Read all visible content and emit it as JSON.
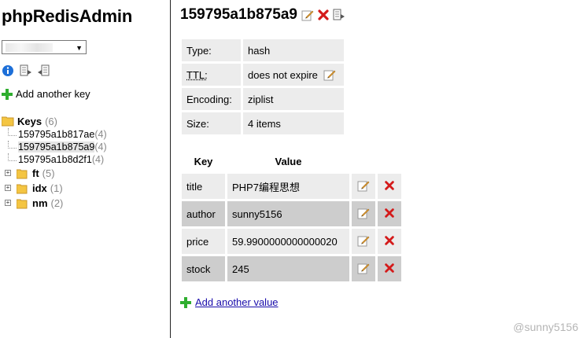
{
  "app": {
    "title": "phpRedisAdmin"
  },
  "sidebar": {
    "server_select_arrow": "▼",
    "icons": [
      "info-icon",
      "export-icon",
      "import-icon"
    ],
    "add_key_label": "Add another key",
    "tree": {
      "root_label": "Keys",
      "root_count": "(6)",
      "keys": [
        {
          "name": "159795a1b817ae",
          "count": "(4)"
        },
        {
          "name": "159795a1b875a9",
          "count": "(4)",
          "selected": true
        },
        {
          "name": "159795a1b8d2f1",
          "count": "(4)"
        }
      ],
      "folders": [
        {
          "name": "ft",
          "count": "(5)"
        },
        {
          "name": "idx",
          "count": "(1)"
        },
        {
          "name": "nm",
          "count": "(2)"
        }
      ]
    }
  },
  "key": {
    "name": "159795a1b875a9",
    "info": {
      "type_label": "Type:",
      "type_value": "hash",
      "ttl_label": "TTL:",
      "ttl_value": "does not expire",
      "encoding_label": "Encoding:",
      "encoding_value": "ziplist",
      "size_label": "Size:",
      "size_value": "4 items"
    },
    "hash": {
      "col_key": "Key",
      "col_value": "Value",
      "rows": [
        {
          "key": "title",
          "value": "PHP7编程思想"
        },
        {
          "key": "author",
          "value": "sunny5156"
        },
        {
          "key": "price",
          "value": "59.9900000000000020"
        },
        {
          "key": "stock",
          "value": "245"
        }
      ]
    },
    "add_value_label": "Add another value"
  },
  "watermark": "@sunny5156",
  "colors": {
    "edit_pencil": "#e8a33a",
    "delete_red": "#d41a1a",
    "add_green": "#2fae2f",
    "folder_yellow": "#f4c542",
    "info_blue": "#1d6fd8",
    "link_blue": "#1a0dab",
    "cell_light": "#ececec",
    "cell_dark": "#cdcdcd"
  }
}
